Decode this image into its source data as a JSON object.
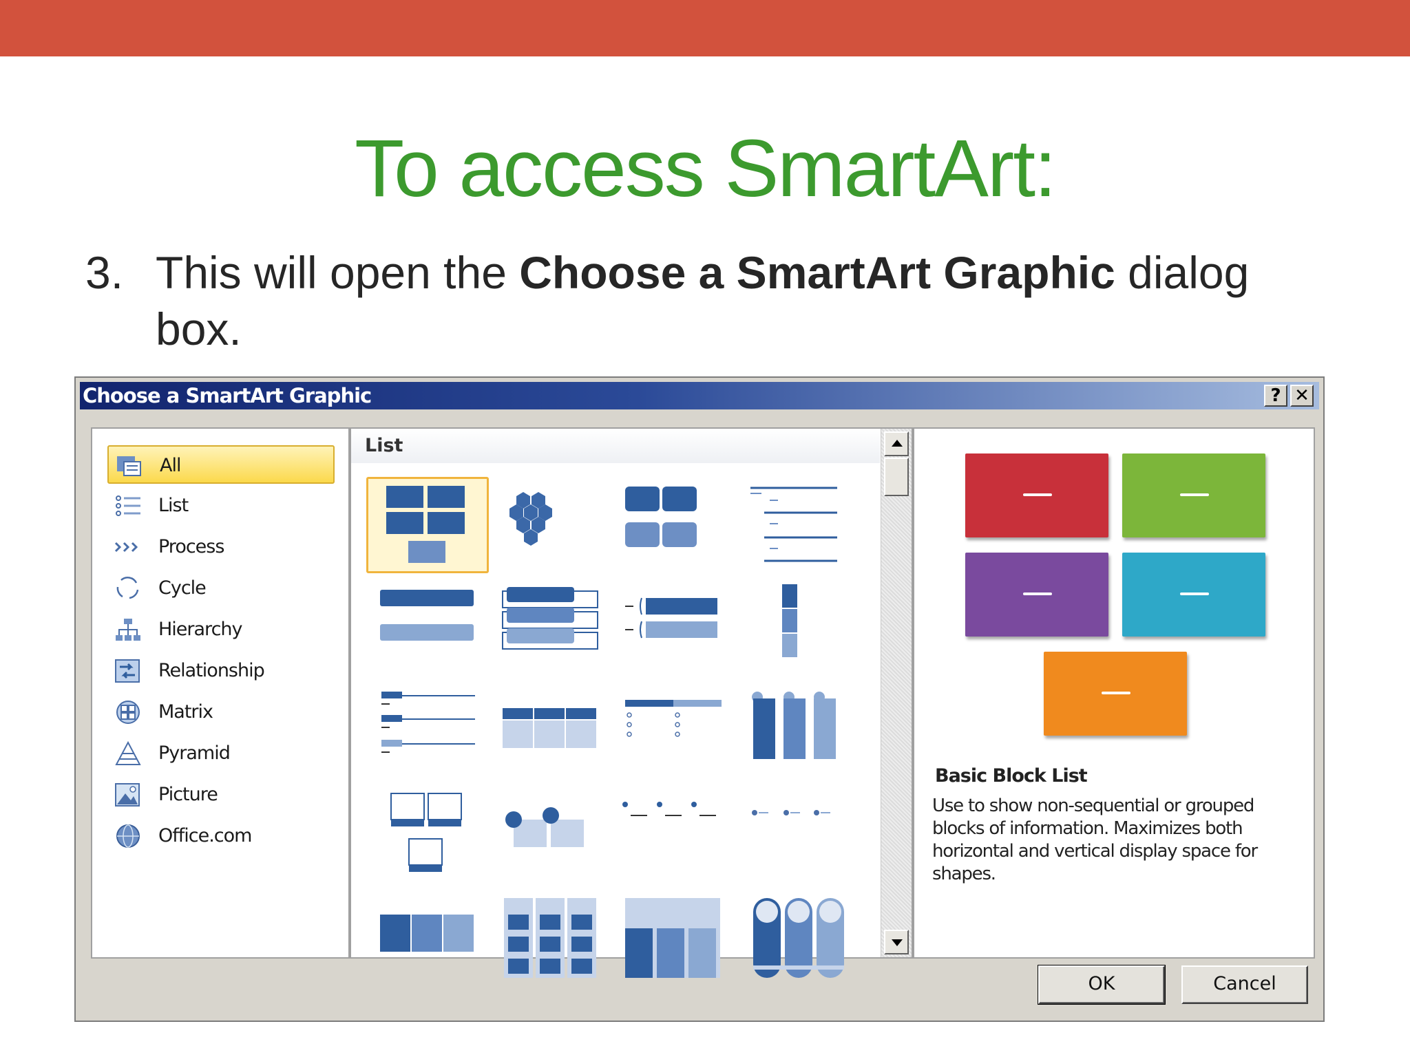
{
  "slide": {
    "title": "To access SmartArt:",
    "step_number": "3.",
    "step_text_before": "This will open the ",
    "step_text_bold": "Choose a SmartArt Graphic",
    "step_text_after": " dialog box."
  },
  "dialog": {
    "title": "Choose a SmartArt Graphic",
    "help_label": "?",
    "close_label": "✕",
    "categories": [
      {
        "label": "All",
        "icon": "all-icon",
        "selected": true
      },
      {
        "label": "List",
        "icon": "list-icon"
      },
      {
        "label": "Process",
        "icon": "process-icon"
      },
      {
        "label": "Cycle",
        "icon": "cycle-icon"
      },
      {
        "label": "Hierarchy",
        "icon": "hierarchy-icon"
      },
      {
        "label": "Relationship",
        "icon": "relationship-icon"
      },
      {
        "label": "Matrix",
        "icon": "matrix-icon"
      },
      {
        "label": "Pyramid",
        "icon": "pyramid-icon"
      },
      {
        "label": "Picture",
        "icon": "picture-icon"
      },
      {
        "label": "Office.com",
        "icon": "globe-icon"
      }
    ],
    "gallery_header": "List",
    "selected_layout": {
      "name": "Basic Block List",
      "description": "Use to show non-sequential or grouped blocks of information. Maximizes both horizontal and vertical display space for shapes.",
      "block_colors": [
        "#c8303a",
        "#7cb63a",
        "#7a4a9e",
        "#2ea8c8",
        "#f08a1e"
      ]
    },
    "ok_label": "OK",
    "cancel_label": "Cancel"
  },
  "colors": {
    "topbar": "#d2523d",
    "title_green": "#3c9a2e",
    "thumb_blue": "#2f5e9e",
    "thumb_light": "#8aa8d2"
  }
}
